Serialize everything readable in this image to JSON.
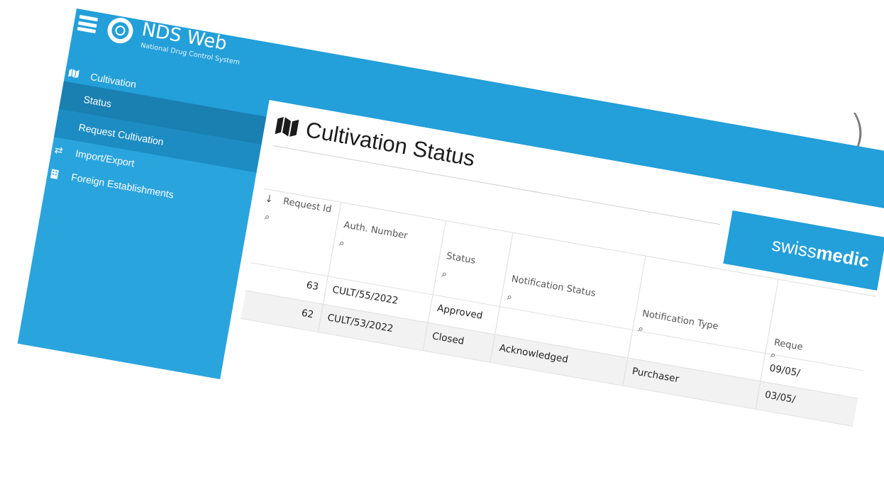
{
  "header": {
    "app_title": "NDS Web",
    "app_subtitle": "National Drug Control System",
    "partner_logo": "swissmedic"
  },
  "sidebar": {
    "items": [
      {
        "label": "Cultivation",
        "icon": "map-icon"
      },
      {
        "label": "Status"
      },
      {
        "label": "Request Cultivation"
      },
      {
        "label": "Import/Export",
        "icon": "exchange-icon"
      },
      {
        "label": "Foreign Establishments",
        "icon": "building-icon"
      }
    ]
  },
  "page": {
    "title": "Cultivation Status"
  },
  "grid": {
    "sort_indicator": "↓",
    "columns": [
      {
        "label": "Request Id"
      },
      {
        "label": "Auth. Number"
      },
      {
        "label": "Status"
      },
      {
        "label": "Notification Status"
      },
      {
        "label": "Notification Type"
      },
      {
        "label": "Reque"
      }
    ],
    "rows": [
      {
        "request_id": "63",
        "auth_number": "CULT/55/2022",
        "status": "Approved",
        "notification_status": "",
        "notification_type": "",
        "request_date": "09/05/"
      },
      {
        "request_id": "62",
        "auth_number": "CULT/53/2022",
        "status": "Closed",
        "notification_status": "Acknowledged",
        "notification_type": "Purchaser",
        "request_date": "03/05/"
      }
    ]
  },
  "background": {
    "paren_top": ")",
    "paren_bottom": ")"
  },
  "colors": {
    "primary": "#239fd9",
    "sidebar_active": "#1a7fb1",
    "sidebar_sub": "#1c8cc3"
  }
}
